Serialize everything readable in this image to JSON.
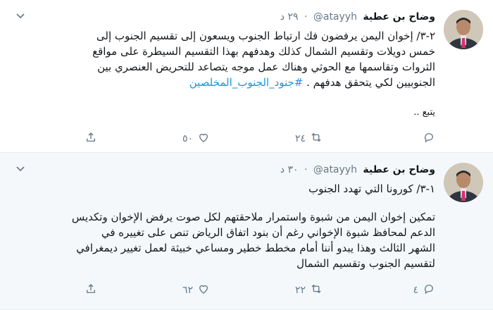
{
  "tweets": [
    {
      "name": "وضاح بن عطية",
      "handle": "@atayyh",
      "dot": "·",
      "time": "٢٩ د",
      "text_lines": [
        "٢-٣/ إخوان اليمن يرفضون فك ارتباط الجنوب ويسعون إلى تقسيم الجنوب إلى",
        "خمس دويلات وتقسيم الشمال كذلك وهدفهم بهذا التقسيم السيطرة على مواقع",
        "الثروات وتقاسمها مع الحوثي وهناك عمل موجه يتصاعد للتحريض العنصري بين"
      ],
      "last_line_text": "الجنوبيين لكي يتحقق هدفهم . ",
      "hashtag": "#جنود_الجنوب_المخلصين",
      "more": "يتبع ..",
      "replies": "",
      "retweets": "٢٤",
      "likes": "٥٠"
    },
    {
      "name": "وضاح بن عطية",
      "handle": "@atayyh",
      "dot": "·",
      "time": "٣٠ د",
      "subtitle": "١-٣/ كورونا التي تهدد الجنوب",
      "text_lines": [
        "تمكين إخوان اليمن من شبوة واستمرار ملاحقتهم لكل صوت يرفض الإخوان وتكديس",
        "الدعم لمحافظ شبوة الإخواني رغم أن بنود اتفاق الرياض تنص على تغييره في",
        "الشهر الثالث وهذا يبدو أننا أمام مخطط خطير ومساعي خبيثة لعمل تغيير ديمغرافي",
        "لتقسيم الجنوب وتقسيم الشمال"
      ],
      "replies": "٤",
      "retweets": "٢٢",
      "likes": "٦٢"
    }
  ],
  "icons": {
    "reply": "reply-icon",
    "retweet": "retweet-icon",
    "like": "heart-icon",
    "share": "share-icon",
    "caret": "chevron-down-icon"
  },
  "colors": {
    "accent": "#1b95e0",
    "muted": "#657786",
    "highlight_bg": "#f5f8fa"
  }
}
